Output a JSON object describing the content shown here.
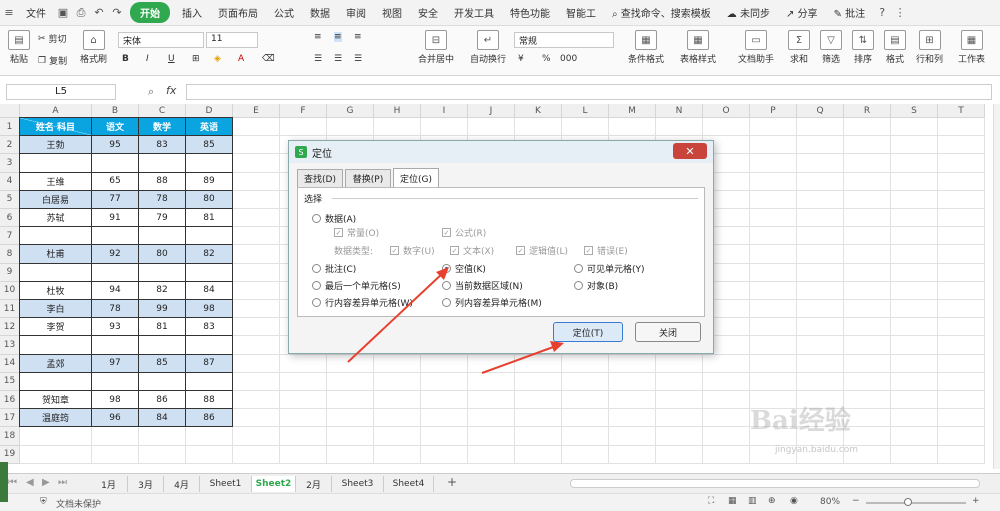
{
  "menubar": {
    "file_label": "文件",
    "items": [
      "开始",
      "插入",
      "页面布局",
      "公式",
      "数据",
      "审阅",
      "视图",
      "安全",
      "开发工具",
      "特色功能",
      "智能工"
    ],
    "active": "开始",
    "search_placeholder": "查找命令、搜索模板",
    "sync": "未同步",
    "share": "分享",
    "annotate": "批注"
  },
  "ribbon": {
    "paste": "粘贴",
    "cut": "剪切",
    "copy": "复制",
    "format_painter": "格式刷",
    "font": "宋体",
    "font_size": "11",
    "number_format": "常规",
    "merge_center": "合并居中",
    "wrap": "自动换行",
    "cond_format": "条件格式",
    "table_style": "表格样式",
    "doc_helper": "文档助手",
    "sum": "求和",
    "filter": "筛选",
    "sort": "排序",
    "format": "格式",
    "rows_cols": "行和列",
    "worksheet": "工作表",
    "bold": "B",
    "italic": "I",
    "underline": "U",
    "percent": "%",
    "thousands": "000"
  },
  "formula_bar": {
    "name_box": "L5",
    "fx": "fx",
    "formula": ""
  },
  "columns": [
    "A",
    "B",
    "C",
    "D",
    "E",
    "F",
    "G",
    "H",
    "I",
    "J",
    "K",
    "L",
    "M",
    "N",
    "O",
    "P",
    "Q",
    "R",
    "S",
    "T"
  ],
  "rows": [
    "1",
    "2",
    "3",
    "4",
    "5",
    "6",
    "7",
    "8",
    "9",
    "10",
    "11",
    "12",
    "13",
    "14",
    "15",
    "16",
    "17",
    "18",
    "19"
  ],
  "table": {
    "header": {
      "name_subject": "姓名      科目",
      "chinese": "语文",
      "math": "数学",
      "english": "英语"
    },
    "rows": [
      {
        "name": "王勃",
        "c": "95",
        "m": "83",
        "e": "85",
        "blue": true
      },
      {
        "name": "",
        "c": "",
        "m": "",
        "e": "",
        "blue": false
      },
      {
        "name": "王维",
        "c": "65",
        "m": "88",
        "e": "89",
        "blue": false
      },
      {
        "name": "白居易",
        "c": "77",
        "m": "78",
        "e": "80",
        "blue": true
      },
      {
        "name": "苏轼",
        "c": "91",
        "m": "79",
        "e": "81",
        "blue": false
      },
      {
        "name": "",
        "c": "",
        "m": "",
        "e": "",
        "blue": false
      },
      {
        "name": "杜甫",
        "c": "92",
        "m": "80",
        "e": "82",
        "blue": true
      },
      {
        "name": "",
        "c": "",
        "m": "",
        "e": "",
        "blue": false
      },
      {
        "name": "杜牧",
        "c": "94",
        "m": "82",
        "e": "84",
        "blue": false
      },
      {
        "name": "李白",
        "c": "78",
        "m": "99",
        "e": "98",
        "blue": true
      },
      {
        "name": "李贺",
        "c": "93",
        "m": "81",
        "e": "83",
        "blue": false
      },
      {
        "name": "",
        "c": "",
        "m": "",
        "e": "",
        "blue": false
      },
      {
        "name": "孟郊",
        "c": "97",
        "m": "85",
        "e": "87",
        "blue": true
      },
      {
        "name": "",
        "c": "",
        "m": "",
        "e": "",
        "blue": false
      },
      {
        "name": "贺知章",
        "c": "98",
        "m": "86",
        "e": "88",
        "blue": false
      },
      {
        "name": "温庭筠",
        "c": "96",
        "m": "84",
        "e": "86",
        "blue": true
      }
    ]
  },
  "sheets": [
    "1月",
    "3月",
    "4月",
    "Sheet1",
    "Sheet2",
    "2月",
    "Sheet3",
    "Sheet4"
  ],
  "active_sheet": "Sheet2",
  "status": {
    "unprotected": "文档未保护",
    "zoom": "80%"
  },
  "dialog": {
    "title": "定位",
    "tabs": [
      "查找(D)",
      "替换(P)",
      "定位(G)"
    ],
    "active_tab": "定位(G)",
    "section": "选择",
    "data": "数据(A)",
    "constant": "常量(O)",
    "formula": "公式(R)",
    "data_type": "数据类型:",
    "number": "数字(U)",
    "text": "文本(X)",
    "logical": "逻辑值(L)",
    "error": "错误(E)",
    "comment": "批注(C)",
    "blank": "空值(K)",
    "visible": "可见单元格(Y)",
    "last_cell": "最后一个单元格(S)",
    "current_region": "当前数据区域(N)",
    "object": "对象(B)",
    "row_diff": "行内容差异单元格(W)",
    "col_diff": "列内容差异单元格(M)",
    "ok": "定位(T)",
    "close": "关闭"
  },
  "watermark": {
    "brand": "Bai经验",
    "url": "jingyan.baidu.com"
  },
  "colors": {
    "green": "#2fa84f",
    "header_blue": "#0aa5e0",
    "row_blue": "#cfe0f3",
    "arrow_red": "#e8402f"
  }
}
